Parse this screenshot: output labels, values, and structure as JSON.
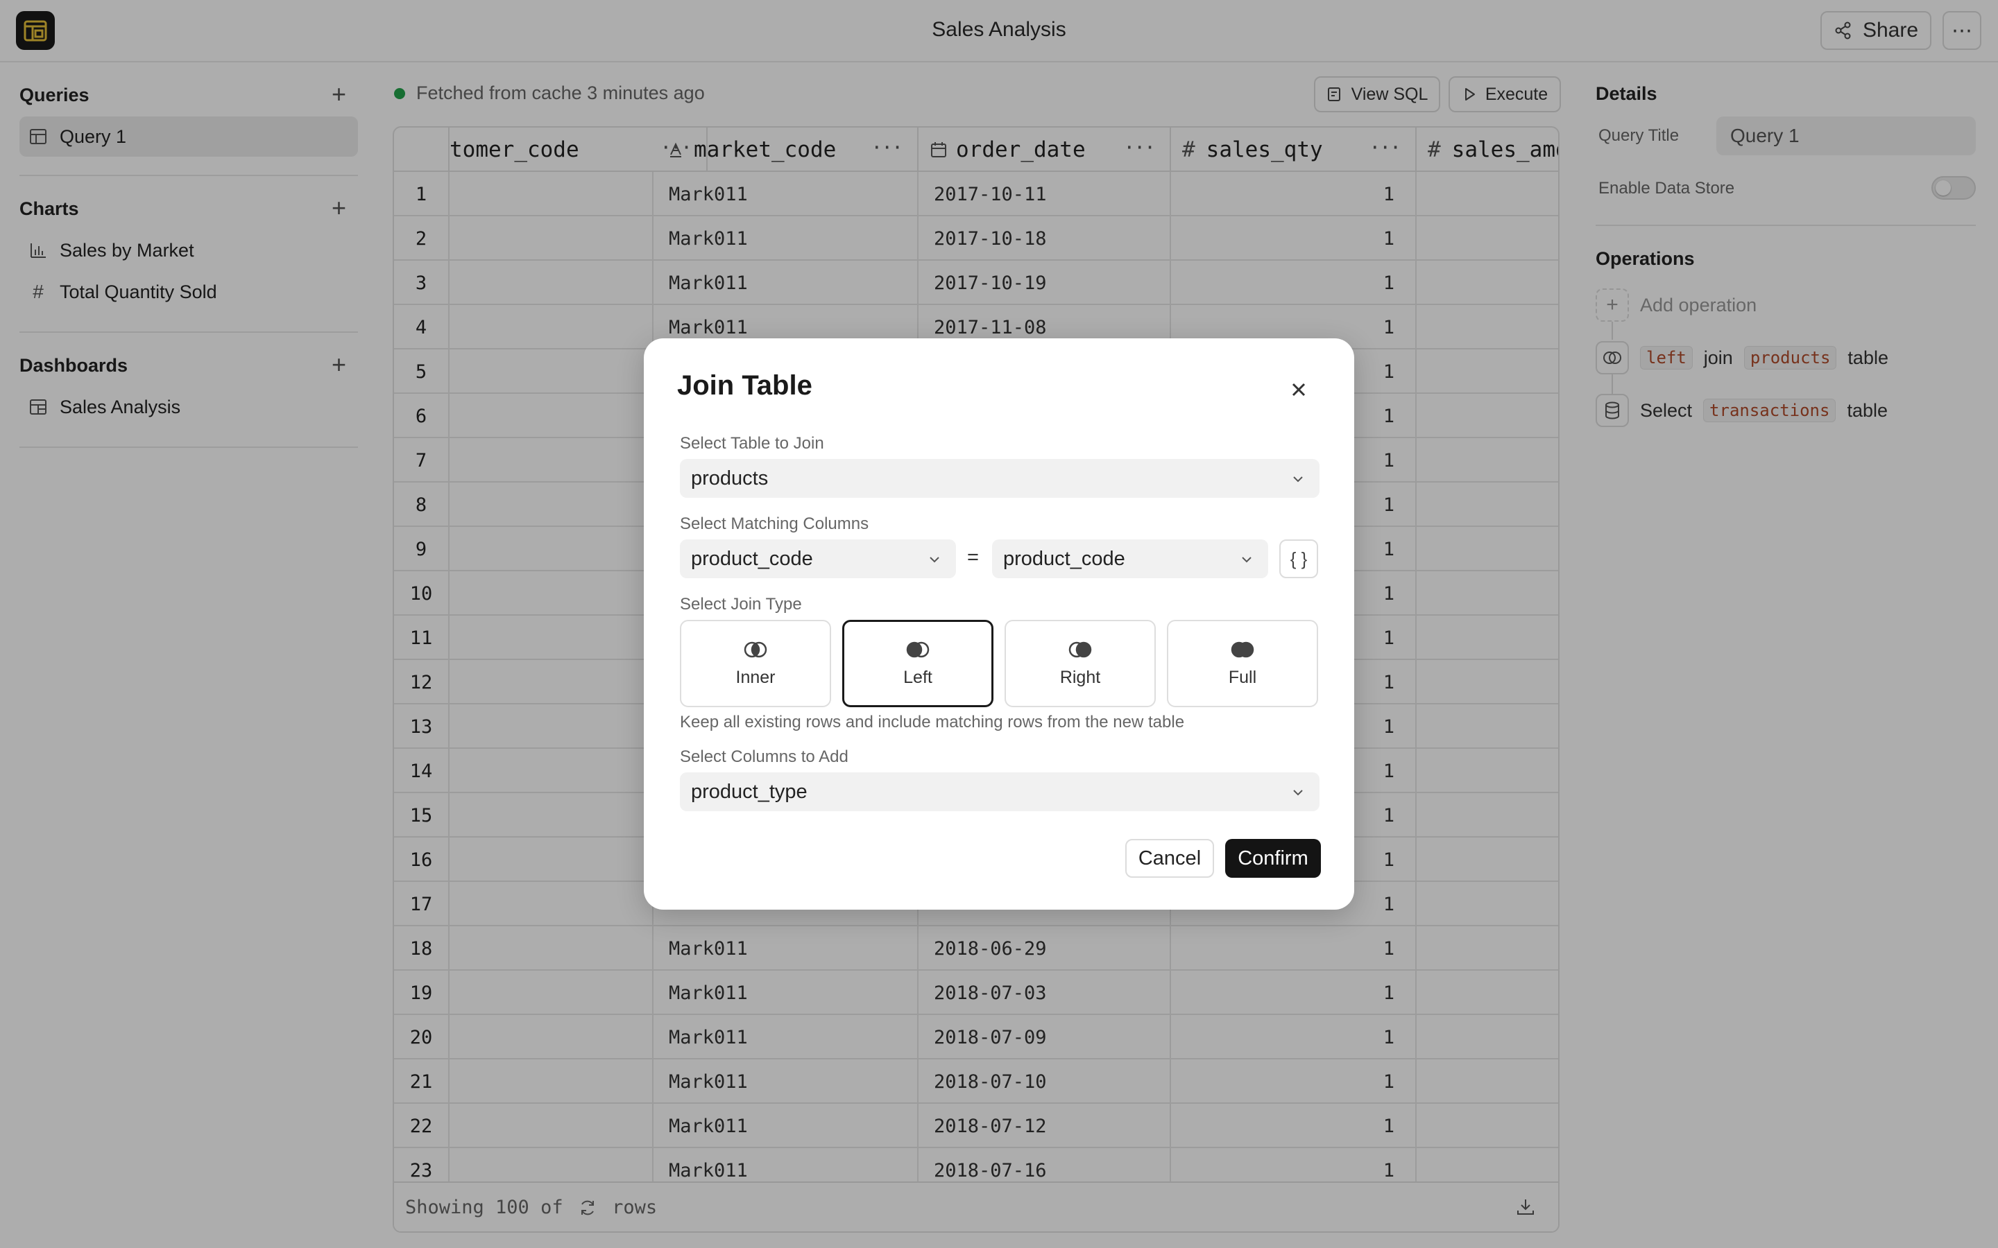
{
  "app": {
    "title": "Sales Analysis",
    "share_label": "Share"
  },
  "sidebar": {
    "queries": {
      "heading": "Queries",
      "items": [
        {
          "label": "Query 1"
        }
      ]
    },
    "charts": {
      "heading": "Charts",
      "items": [
        {
          "label": "Sales by Market"
        },
        {
          "label": "Total Quantity Sold"
        }
      ]
    },
    "dashboards": {
      "heading": "Dashboards",
      "items": [
        {
          "label": "Sales Analysis"
        }
      ]
    }
  },
  "main": {
    "status": "Fetched from cache 3 minutes ago",
    "view_sql_label": "View SQL",
    "execute_label": "Execute",
    "columns": [
      "tomer_code",
      "market_code",
      "order_date",
      "sales_qty",
      "sales_amo"
    ],
    "rows": [
      {
        "n": "1",
        "market": "Mark011",
        "date": "2017-10-11",
        "qty": "1"
      },
      {
        "n": "2",
        "market": "Mark011",
        "date": "2017-10-18",
        "qty": "1"
      },
      {
        "n": "3",
        "market": "Mark011",
        "date": "2017-10-19",
        "qty": "1"
      },
      {
        "n": "4",
        "market": "Mark011",
        "date": "2017-11-08",
        "qty": "1"
      },
      {
        "n": "5",
        "market": "",
        "date": "",
        "qty": "1"
      },
      {
        "n": "6",
        "market": "",
        "date": "",
        "qty": "1"
      },
      {
        "n": "7",
        "market": "",
        "date": "",
        "qty": "1"
      },
      {
        "n": "8",
        "market": "",
        "date": "",
        "qty": "1"
      },
      {
        "n": "9",
        "market": "",
        "date": "",
        "qty": "1"
      },
      {
        "n": "10",
        "market": "",
        "date": "",
        "qty": "1"
      },
      {
        "n": "11",
        "market": "",
        "date": "",
        "qty": "1"
      },
      {
        "n": "12",
        "market": "",
        "date": "",
        "qty": "1"
      },
      {
        "n": "13",
        "market": "",
        "date": "",
        "qty": "1"
      },
      {
        "n": "14",
        "market": "",
        "date": "",
        "qty": "1"
      },
      {
        "n": "15",
        "market": "",
        "date": "",
        "qty": "1"
      },
      {
        "n": "16",
        "market": "",
        "date": "",
        "qty": "1"
      },
      {
        "n": "17",
        "market": "",
        "date": "",
        "qty": "1"
      },
      {
        "n": "18",
        "market": "Mark011",
        "date": "2018-06-29",
        "qty": "1"
      },
      {
        "n": "19",
        "market": "Mark011",
        "date": "2018-07-03",
        "qty": "1"
      },
      {
        "n": "20",
        "market": "Mark011",
        "date": "2018-07-09",
        "qty": "1"
      },
      {
        "n": "21",
        "market": "Mark011",
        "date": "2018-07-10",
        "qty": "1"
      },
      {
        "n": "22",
        "market": "Mark011",
        "date": "2018-07-12",
        "qty": "1"
      },
      {
        "n": "23",
        "market": "Mark011",
        "date": "2018-07-16",
        "qty": "1"
      }
    ],
    "footer": {
      "prefix": "Showing 100 of",
      "suffix": "rows"
    }
  },
  "details": {
    "heading": "Details",
    "query_title_label": "Query Title",
    "query_title_value": "Query 1",
    "data_store_label": "Enable Data Store",
    "data_store_enabled": false,
    "operations_heading": "Operations",
    "add_operation": "Add operation",
    "ops": [
      {
        "t1": "left",
        "t2": "join",
        "t3": "products",
        "t4": "table"
      },
      {
        "t1": "Select",
        "t2": "transactions",
        "t3": "table"
      }
    ]
  },
  "modal": {
    "title": "Join Table",
    "table_label": "Select Table to Join",
    "table_value": "products",
    "matching_label": "Select Matching Columns",
    "left_col": "product_code",
    "equals": "=",
    "right_col": "product_code",
    "braces": "{ }",
    "join_type_label": "Select Join Type",
    "join_types": [
      "Inner",
      "Left",
      "Right",
      "Full"
    ],
    "selected_join_type": "Left",
    "help": "Keep all existing rows and include matching rows from the new table",
    "columns_label": "Select Columns to Add",
    "columns_value": "product_type",
    "cancel_label": "Cancel",
    "confirm_label": "Confirm"
  }
}
